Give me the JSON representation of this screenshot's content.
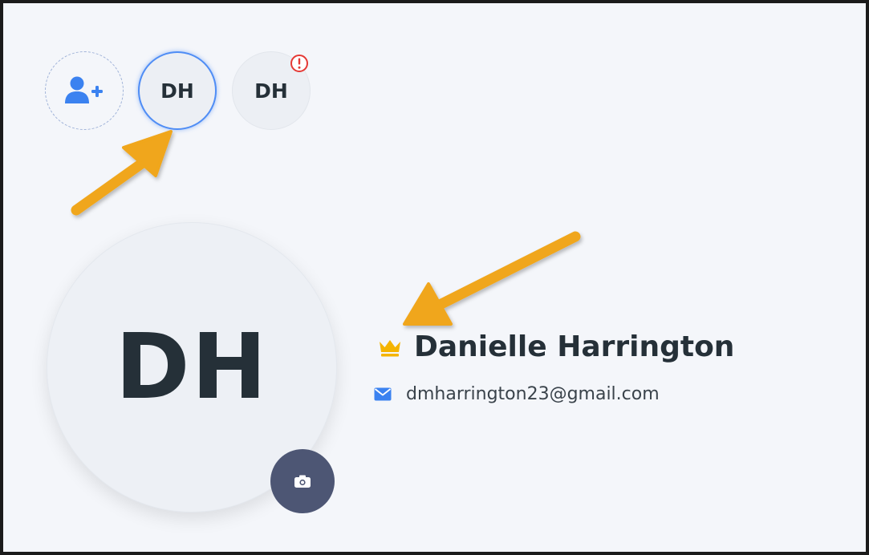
{
  "accounts": {
    "add_account_icon": "add-user-icon",
    "items": [
      {
        "initials": "DH",
        "state": "active"
      },
      {
        "initials": "DH",
        "state": "alert",
        "badge_icon": "alert-circle-icon"
      }
    ]
  },
  "profile": {
    "initials": "DH",
    "name": "Danielle Harrington",
    "email": "dmharrington23@gmail.com",
    "owner_icon": "crown-icon",
    "email_icon": "envelope-icon",
    "photo_button_icon": "camera-icon"
  },
  "colors": {
    "accent_blue": "#4f8df5",
    "crown": "#f4b400",
    "alert_red": "#e53935",
    "camera_button": "#4d5674",
    "annotation_arrow": "#f0a61a"
  }
}
